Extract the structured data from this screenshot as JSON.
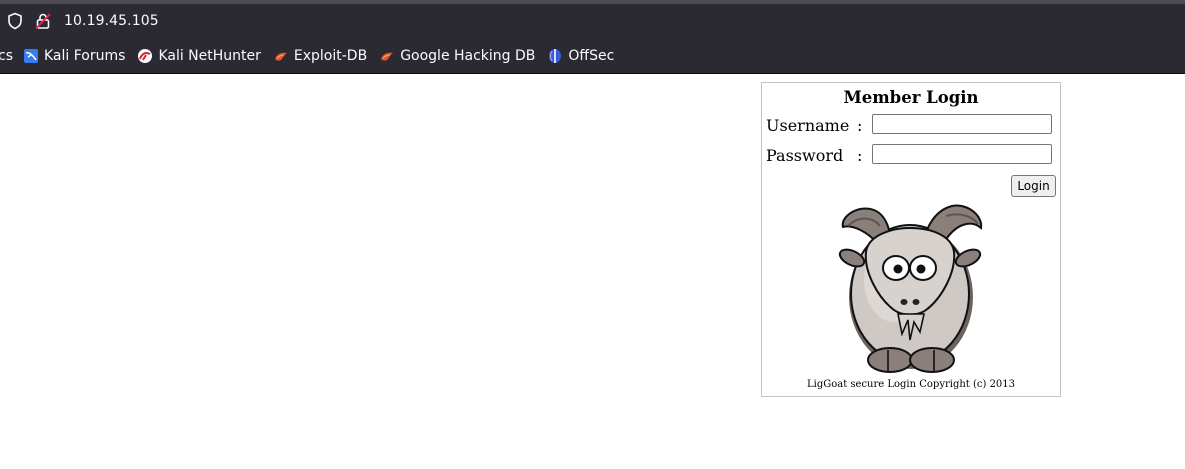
{
  "browser": {
    "url": "10.19.45.105",
    "bookmarks": [
      {
        "label": "cs",
        "icon": "cut-off-bookmark"
      },
      {
        "label": "Kali Forums",
        "icon": "kali-forums-icon"
      },
      {
        "label": "Kali NetHunter",
        "icon": "kali-nethunter-icon"
      },
      {
        "label": "Exploit-DB",
        "icon": "exploit-db-icon"
      },
      {
        "label": "Google Hacking DB",
        "icon": "exploit-db-icon"
      },
      {
        "label": "OffSec",
        "icon": "offsec-icon"
      }
    ]
  },
  "login": {
    "title": "Member Login",
    "username_label": "Username",
    "password_label": "Password",
    "colon": ":",
    "username_value": "",
    "password_value": "",
    "button_label": "Login",
    "image": "goat-illustration",
    "footer": "LigGoat secure Login Copyright (c) 2013"
  },
  "colors": {
    "chrome_bg": "#2b2a33",
    "chrome_text": "#fbfbfe",
    "panel_border": "#c4c4c4",
    "page_bg": "#ffffff"
  }
}
